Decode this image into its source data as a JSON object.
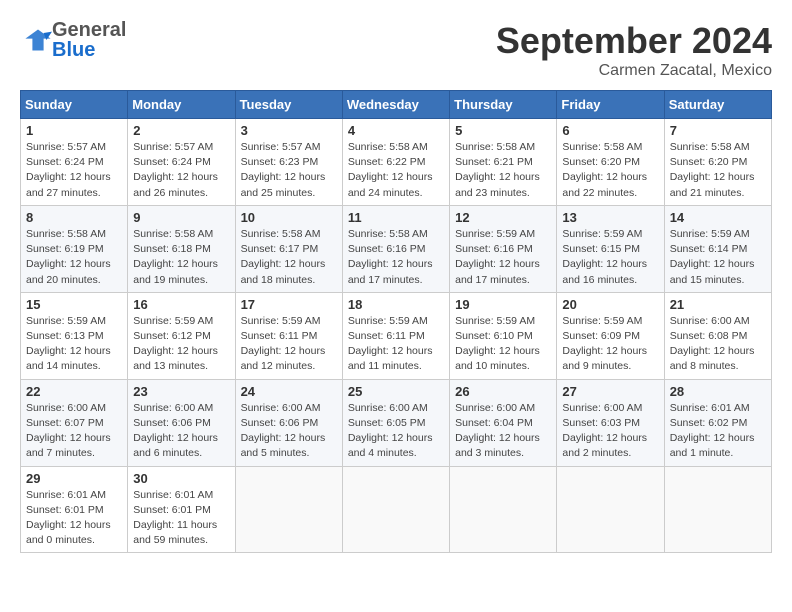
{
  "header": {
    "logo_general": "General",
    "logo_blue": "Blue",
    "month_title": "September 2024",
    "location": "Carmen Zacatal, Mexico"
  },
  "days_of_week": [
    "Sunday",
    "Monday",
    "Tuesday",
    "Wednesday",
    "Thursday",
    "Friday",
    "Saturday"
  ],
  "weeks": [
    [
      {
        "day": "1",
        "info": "Sunrise: 5:57 AM\nSunset: 6:24 PM\nDaylight: 12 hours\nand 27 minutes."
      },
      {
        "day": "2",
        "info": "Sunrise: 5:57 AM\nSunset: 6:24 PM\nDaylight: 12 hours\nand 26 minutes."
      },
      {
        "day": "3",
        "info": "Sunrise: 5:57 AM\nSunset: 6:23 PM\nDaylight: 12 hours\nand 25 minutes."
      },
      {
        "day": "4",
        "info": "Sunrise: 5:58 AM\nSunset: 6:22 PM\nDaylight: 12 hours\nand 24 minutes."
      },
      {
        "day": "5",
        "info": "Sunrise: 5:58 AM\nSunset: 6:21 PM\nDaylight: 12 hours\nand 23 minutes."
      },
      {
        "day": "6",
        "info": "Sunrise: 5:58 AM\nSunset: 6:20 PM\nDaylight: 12 hours\nand 22 minutes."
      },
      {
        "day": "7",
        "info": "Sunrise: 5:58 AM\nSunset: 6:20 PM\nDaylight: 12 hours\nand 21 minutes."
      }
    ],
    [
      {
        "day": "8",
        "info": "Sunrise: 5:58 AM\nSunset: 6:19 PM\nDaylight: 12 hours\nand 20 minutes."
      },
      {
        "day": "9",
        "info": "Sunrise: 5:58 AM\nSunset: 6:18 PM\nDaylight: 12 hours\nand 19 minutes."
      },
      {
        "day": "10",
        "info": "Sunrise: 5:58 AM\nSunset: 6:17 PM\nDaylight: 12 hours\nand 18 minutes."
      },
      {
        "day": "11",
        "info": "Sunrise: 5:58 AM\nSunset: 6:16 PM\nDaylight: 12 hours\nand 17 minutes."
      },
      {
        "day": "12",
        "info": "Sunrise: 5:59 AM\nSunset: 6:16 PM\nDaylight: 12 hours\nand 17 minutes."
      },
      {
        "day": "13",
        "info": "Sunrise: 5:59 AM\nSunset: 6:15 PM\nDaylight: 12 hours\nand 16 minutes."
      },
      {
        "day": "14",
        "info": "Sunrise: 5:59 AM\nSunset: 6:14 PM\nDaylight: 12 hours\nand 15 minutes."
      }
    ],
    [
      {
        "day": "15",
        "info": "Sunrise: 5:59 AM\nSunset: 6:13 PM\nDaylight: 12 hours\nand 14 minutes."
      },
      {
        "day": "16",
        "info": "Sunrise: 5:59 AM\nSunset: 6:12 PM\nDaylight: 12 hours\nand 13 minutes."
      },
      {
        "day": "17",
        "info": "Sunrise: 5:59 AM\nSunset: 6:11 PM\nDaylight: 12 hours\nand 12 minutes."
      },
      {
        "day": "18",
        "info": "Sunrise: 5:59 AM\nSunset: 6:11 PM\nDaylight: 12 hours\nand 11 minutes."
      },
      {
        "day": "19",
        "info": "Sunrise: 5:59 AM\nSunset: 6:10 PM\nDaylight: 12 hours\nand 10 minutes."
      },
      {
        "day": "20",
        "info": "Sunrise: 5:59 AM\nSunset: 6:09 PM\nDaylight: 12 hours\nand 9 minutes."
      },
      {
        "day": "21",
        "info": "Sunrise: 6:00 AM\nSunset: 6:08 PM\nDaylight: 12 hours\nand 8 minutes."
      }
    ],
    [
      {
        "day": "22",
        "info": "Sunrise: 6:00 AM\nSunset: 6:07 PM\nDaylight: 12 hours\nand 7 minutes."
      },
      {
        "day": "23",
        "info": "Sunrise: 6:00 AM\nSunset: 6:06 PM\nDaylight: 12 hours\nand 6 minutes."
      },
      {
        "day": "24",
        "info": "Sunrise: 6:00 AM\nSunset: 6:06 PM\nDaylight: 12 hours\nand 5 minutes."
      },
      {
        "day": "25",
        "info": "Sunrise: 6:00 AM\nSunset: 6:05 PM\nDaylight: 12 hours\nand 4 minutes."
      },
      {
        "day": "26",
        "info": "Sunrise: 6:00 AM\nSunset: 6:04 PM\nDaylight: 12 hours\nand 3 minutes."
      },
      {
        "day": "27",
        "info": "Sunrise: 6:00 AM\nSunset: 6:03 PM\nDaylight: 12 hours\nand 2 minutes."
      },
      {
        "day": "28",
        "info": "Sunrise: 6:01 AM\nSunset: 6:02 PM\nDaylight: 12 hours\nand 1 minute."
      }
    ],
    [
      {
        "day": "29",
        "info": "Sunrise: 6:01 AM\nSunset: 6:01 PM\nDaylight: 12 hours\nand 0 minutes."
      },
      {
        "day": "30",
        "info": "Sunrise: 6:01 AM\nSunset: 6:01 PM\nDaylight: 11 hours\nand 59 minutes."
      },
      {
        "day": "",
        "info": ""
      },
      {
        "day": "",
        "info": ""
      },
      {
        "day": "",
        "info": ""
      },
      {
        "day": "",
        "info": ""
      },
      {
        "day": "",
        "info": ""
      }
    ]
  ]
}
